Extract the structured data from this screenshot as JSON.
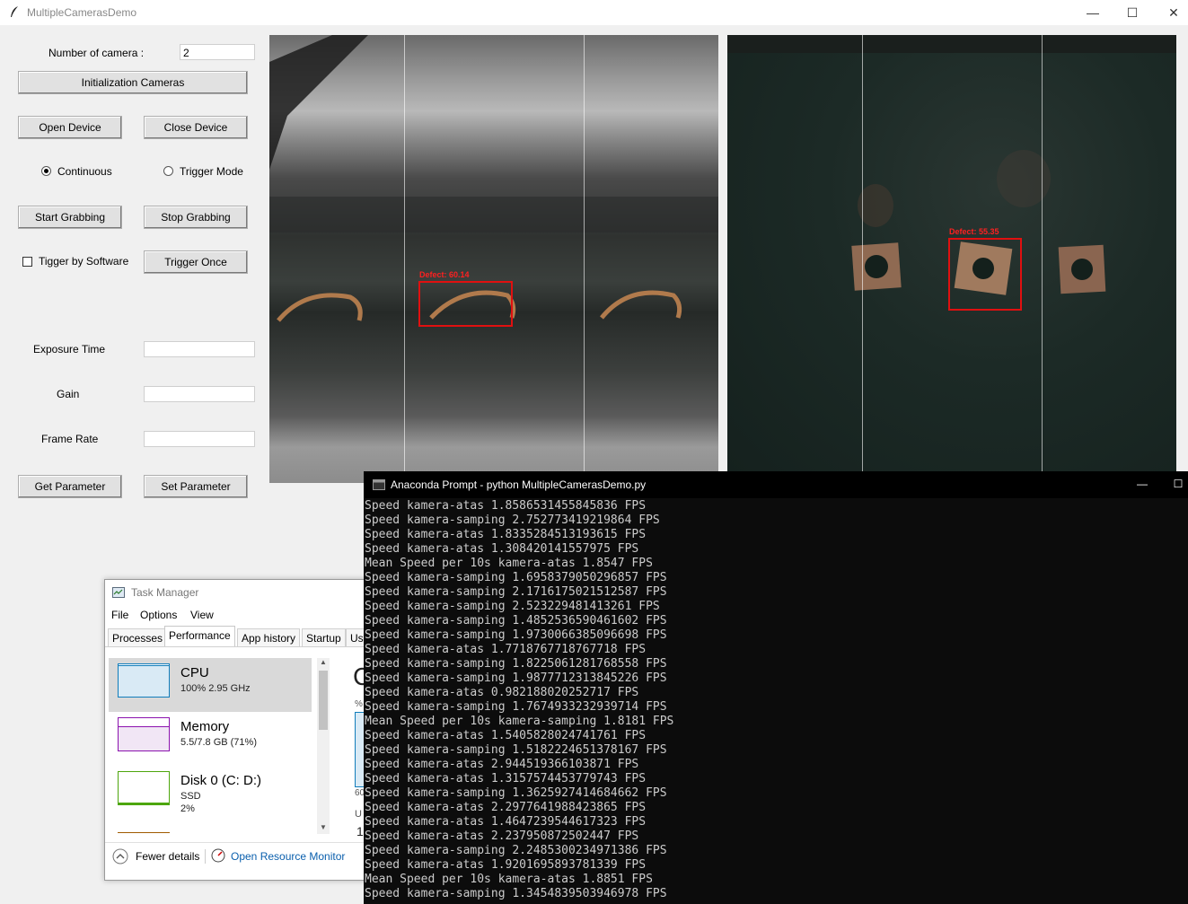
{
  "window": {
    "title": "MultipleCamerasDemo",
    "icon": "feather-icon"
  },
  "controls": {
    "num_camera_label": "Number of camera :",
    "num_camera_value": "2",
    "init_button": "Initialization Cameras",
    "open_device": "Open Device",
    "close_device": "Close Device",
    "continuous_label": "Continuous",
    "trigger_mode_label": "Trigger Mode",
    "selected_mode": "Continuous",
    "start_grabbing": "Start Grabbing",
    "stop_grabbing": "Stop Grabbing",
    "trigger_software_label": "Tigger by Software",
    "trigger_software_checked": false,
    "trigger_once": "Trigger Once",
    "exposure_label": "Exposure Time",
    "exposure_value": "",
    "gain_label": "Gain",
    "gain_value": "",
    "frame_rate_label": "Frame Rate",
    "frame_rate_value": "",
    "get_parameter": "Get Parameter",
    "set_parameter": "Set Parameter"
  },
  "cameras": [
    {
      "defect_label": "Defect: 60.14"
    },
    {
      "defect_label": "Defect: 55.35"
    }
  ],
  "task_manager": {
    "title": "Task Manager",
    "menu": [
      "File",
      "Options",
      "View"
    ],
    "tabs": [
      "Processes",
      "Performance",
      "App history",
      "Startup",
      "Us"
    ],
    "active_tab": "Performance",
    "items": [
      {
        "name": "CPU",
        "sub1": "100%  2.95 GHz",
        "sub2": "",
        "color": "#117dbb"
      },
      {
        "name": "Memory",
        "sub1": "5.5/7.8 GB (71%)",
        "sub2": "",
        "color": "#8b12ae"
      },
      {
        "name": "Disk 0 (C: D:)",
        "sub1": "SSD",
        "sub2": "2%",
        "color": "#4da60c"
      }
    ],
    "cpu_util_percent": 100,
    "right_fragments": {
      "big": "C",
      "pct": "%",
      "sixty": "60",
      "u": "U",
      "one": "1"
    },
    "fewer_details": "Fewer details",
    "open_resource_monitor": "Open Resource Monitor"
  },
  "console": {
    "title": "Anaconda Prompt - python  MultipleCamerasDemo.py",
    "lines": [
      "Speed kamera-atas 1.8586531455845836 FPS",
      "Speed kamera-samping 2.752773419219864 FPS",
      "Speed kamera-atas 1.8335284513193615 FPS",
      "Speed kamera-atas 1.308420141557975 FPS",
      "Mean Speed per 10s kamera-atas 1.8547 FPS",
      "Speed kamera-samping 1.6958379050296857 FPS",
      "Speed kamera-samping 2.1716175021512587 FPS",
      "Speed kamera-samping 2.523229481413261 FPS",
      "Speed kamera-samping 1.4852536590461602 FPS",
      "Speed kamera-samping 1.9730066385096698 FPS",
      "Speed kamera-atas 1.7718767718767718 FPS",
      "Speed kamera-samping 1.8225061281768558 FPS",
      "Speed kamera-samping 1.9877712313845226 FPS",
      "Speed kamera-atas 0.982188020252717 FPS",
      "Speed kamera-samping 1.7674933232939714 FPS",
      "Mean Speed per 10s kamera-samping 1.8181 FPS",
      "Speed kamera-atas 1.5405828024741761 FPS",
      "Speed kamera-samping 1.5182224651378167 FPS",
      "Speed kamera-atas 2.944519366103871 FPS",
      "Speed kamera-atas 1.3157574453779743 FPS",
      "Speed kamera-samping 1.3625927414684662 FPS",
      "Speed kamera-atas 2.2977641988423865 FPS",
      "Speed kamera-atas 1.4647239544617323 FPS",
      "Speed kamera-atas 2.237950872502447 FPS",
      "Speed kamera-samping 2.2485300234971386 FPS",
      "Speed kamera-atas 1.9201695893781339 FPS",
      "Mean Speed per 10s kamera-atas 1.8851 FPS",
      "Speed kamera-samping 1.3454839503946978 FPS"
    ]
  }
}
